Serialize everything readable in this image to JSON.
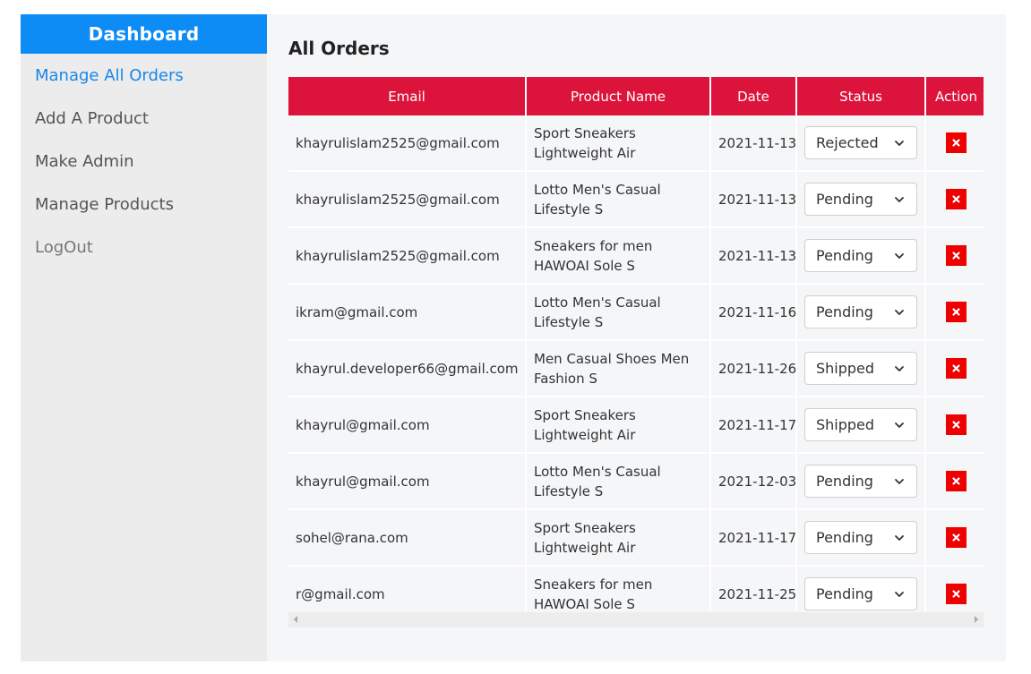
{
  "sidebar": {
    "title": "Dashboard",
    "items": [
      {
        "label": "Manage All Orders",
        "active": true
      },
      {
        "label": "Add A Product"
      },
      {
        "label": "Make Admin"
      },
      {
        "label": "Manage Products"
      },
      {
        "label": "LogOut"
      }
    ]
  },
  "main": {
    "title": "All Orders",
    "table": {
      "headers": [
        "Email",
        "Product Name",
        "Date",
        "Status",
        "Action"
      ],
      "rows": [
        {
          "email": "khayrulislam2525@gmail.com",
          "product_line1": "Sport Sneakers",
          "product_line2": "Lightweight Air",
          "date": "2021-11-13",
          "status": "Rejected"
        },
        {
          "email": "khayrulislam2525@gmail.com",
          "product_line1": "Lotto Men's Casual",
          "product_line2": "Lifestyle S",
          "date": "2021-11-13",
          "status": "Pending"
        },
        {
          "email": "khayrulislam2525@gmail.com",
          "product_line1": "Sneakers for men",
          "product_line2": "HAWOAI Sole S",
          "date": "2021-11-13",
          "status": "Pending"
        },
        {
          "email": "ikram@gmail.com",
          "product_line1": "Lotto Men's Casual",
          "product_line2": "Lifestyle S",
          "date": "2021-11-16",
          "status": "Pending"
        },
        {
          "email": "khayrul.developer66@gmail.com",
          "product_line1": "Men Casual Shoes Men",
          "product_line2": "Fashion S",
          "date": "2021-11-26",
          "status": "Shipped"
        },
        {
          "email": "khayrul@gmail.com",
          "product_line1": "Sport Sneakers",
          "product_line2": "Lightweight Air",
          "date": "2021-11-17",
          "status": "Shipped"
        },
        {
          "email": "khayrul@gmail.com",
          "product_line1": "Lotto Men's Casual",
          "product_line2": "Lifestyle S",
          "date": "2021-12-03",
          "status": "Pending"
        },
        {
          "email": "sohel@rana.com",
          "product_line1": "Sport Sneakers",
          "product_line2": "Lightweight Air",
          "date": "2021-11-17",
          "status": "Pending"
        },
        {
          "email": "r@gmail.com",
          "product_line1": "Sneakers for men",
          "product_line2": "HAWOAI Sole S",
          "date": "2021-11-25",
          "status": "Pending"
        }
      ]
    }
  },
  "icons": {
    "dropdown": "chevron-down-icon",
    "delete": "close-icon"
  },
  "colors": {
    "sidebar_header": "#0d8cf5",
    "active_link": "#1a86e8",
    "table_header": "#dc143c",
    "delete_button": "#ee0000"
  }
}
